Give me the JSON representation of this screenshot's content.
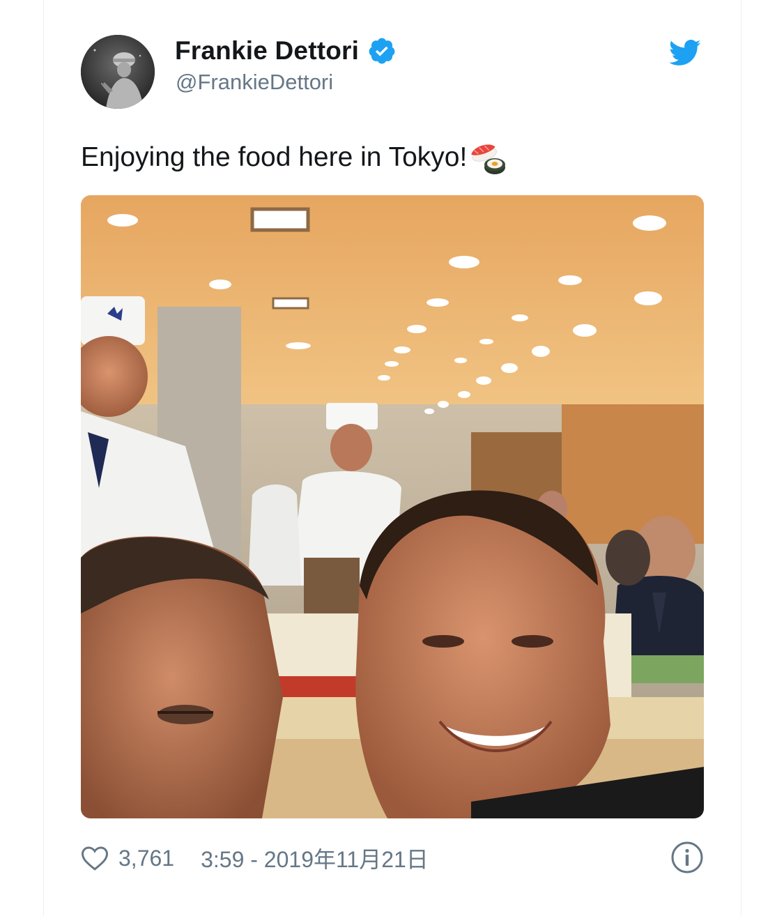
{
  "tweet": {
    "author": {
      "display_name": "Frankie Dettori",
      "handle": "@FrankieDettori",
      "verified": true,
      "avatar_icon": "jockey-avatar"
    },
    "text": "Enjoying the food here in Tokyo!",
    "emoji_icon": "sushi-emoji",
    "media": {
      "type": "photo",
      "icon": "selfie-photo"
    },
    "likes": "3,761",
    "timestamp": "3:59 - 2019年11月21日"
  },
  "icons": {
    "brand": "twitter-bird-icon",
    "like": "heart-icon",
    "info": "info-icon",
    "verified": "verified-badge-icon"
  },
  "colors": {
    "text_primary": "#14171a",
    "text_secondary": "#657786",
    "twitter_blue": "#1da1f2",
    "border": "#eceff2"
  }
}
